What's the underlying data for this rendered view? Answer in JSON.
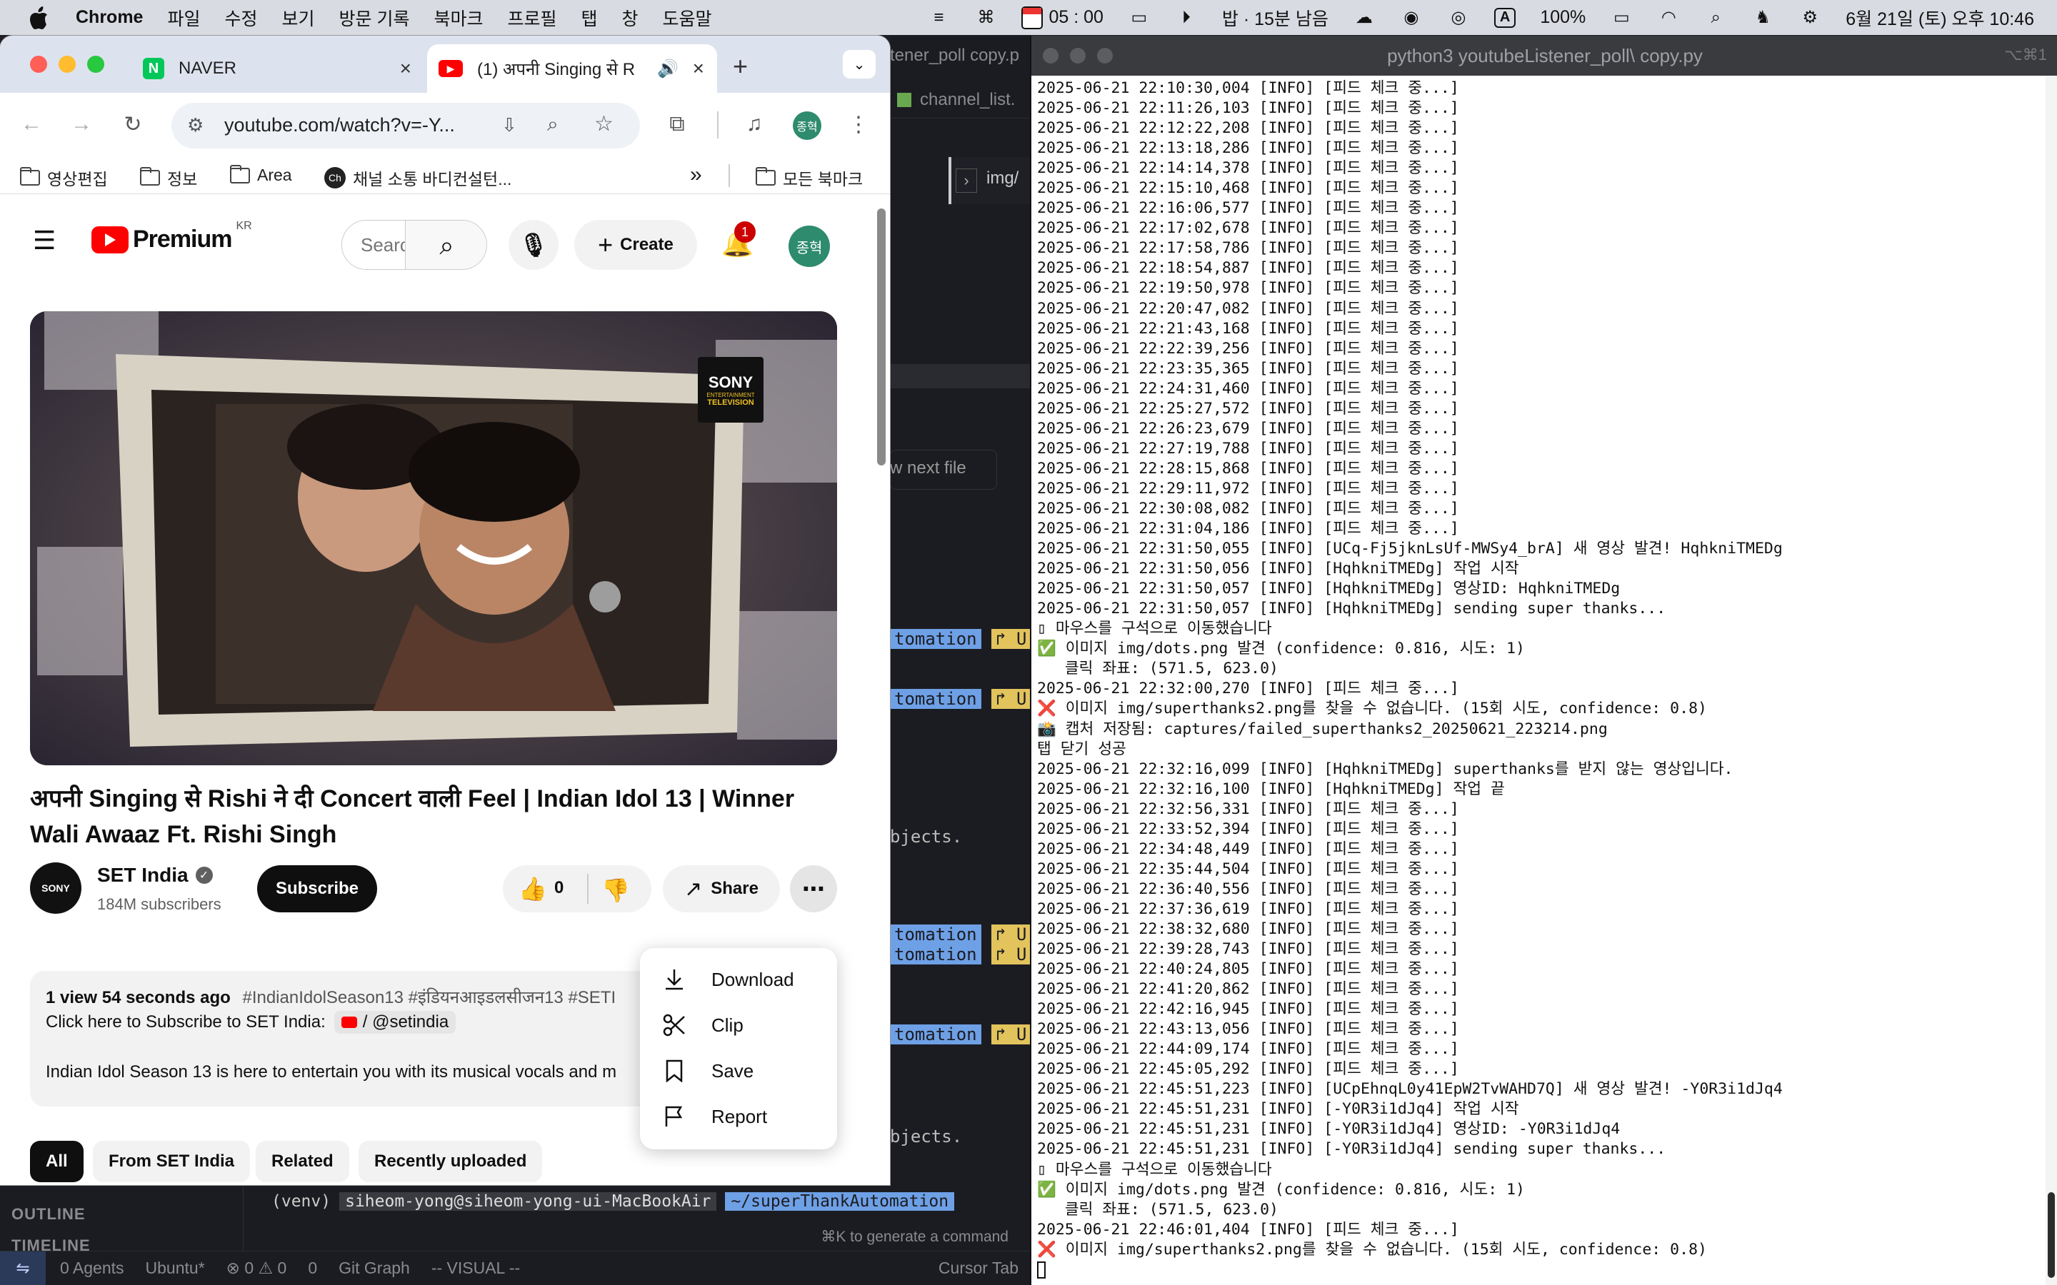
{
  "menubar": {
    "app": "Chrome",
    "items": [
      "파일",
      "수정",
      "보기",
      "방문 기록",
      "북마크",
      "프로필",
      "탭",
      "창",
      "도움말"
    ],
    "timer": "05 : 00",
    "rice": "밥 · 15분 남음",
    "input_source": "A",
    "battery": "100%",
    "datetime": "6월 21일 (토) 오후 10:46"
  },
  "chrome": {
    "tabs": [
      {
        "title": "NAVER",
        "fav": "N",
        "fav_color": "#03c75a"
      },
      {
        "title": "(1) अपनी Singing से R",
        "fav": "▶",
        "fav_color": "#ff0000"
      }
    ],
    "url": "youtube.com/watch?v=-Y...",
    "profile": "종혁",
    "bookmarks": [
      "영상편집",
      "정보",
      "Area",
      "채널 소통 바디컨설턴...",
      "모든 북마크"
    ]
  },
  "youtube": {
    "logo_text": "Premium",
    "region": "KR",
    "search_placeholder": "Search",
    "create_label": "Create",
    "notif_count": "1",
    "avatar": "종혁",
    "video_title": "अपनी Singing से Rishi ने दी Concert वाली Feel | Indian Idol 13 | Winner Wali Awaaz Ft. Rishi Singh",
    "watermark_line1": "SONY",
    "watermark_line2": "ENTERTAINMENT",
    "watermark_line3": "TELEVISION",
    "channel": "SET India",
    "subscribers": "184M subscribers",
    "subscribe": "Subscribe",
    "likes": "0",
    "share": "Share",
    "menu": [
      "Download",
      "Clip",
      "Save",
      "Report"
    ],
    "desc_stats": "1 view  54 seconds ago",
    "desc_tags": "#IndianIdolSeason13 #इंडियनआइडलसीजन13 #SETI",
    "desc_line2": "Click here to Subscribe to SET India:",
    "desc_handle": "/ @setindia",
    "desc_line3": "Indian Idol Season 13 is here to entertain you with its musical vocals and m",
    "chips": [
      "All",
      "From SET India",
      "Related",
      "Recently uploaded"
    ]
  },
  "editor": {
    "tab1": "tener_poll copy.p",
    "tab2": "channel_list.",
    "path": "img/",
    "next_file": "w next file",
    "pill_blue": "tomation",
    "pill_yellow": "↱ U",
    "objects": "bjects.",
    "sidebar_outline": "OUTLINE",
    "sidebar_timeline": "TIMELINE",
    "prompt_env": "(venv)",
    "prompt_user": "siheom-yong@siheom-yong-ui-MacBookAir",
    "prompt_path": "~/superThankAutomation",
    "hint": "⌘K to generate a command",
    "status": [
      "0 Agents",
      "Ubuntu*",
      "⊗ 0 ⚠ 0",
      "0",
      "Git Graph",
      "-- VISUAL --",
      "Cursor Tab"
    ]
  },
  "terminal": {
    "title": "python3 youtubeListener_poll\\ copy.py",
    "shortcut": "⌥⌘1",
    "lines": [
      "2025-06-21 22:10:30,004 [INFO] [피드 체크 중...]",
      "2025-06-21 22:11:26,103 [INFO] [피드 체크 중...]",
      "2025-06-21 22:12:22,208 [INFO] [피드 체크 중...]",
      "2025-06-21 22:13:18,286 [INFO] [피드 체크 중...]",
      "2025-06-21 22:14:14,378 [INFO] [피드 체크 중...]",
      "2025-06-21 22:15:10,468 [INFO] [피드 체크 중...]",
      "2025-06-21 22:16:06,577 [INFO] [피드 체크 중...]",
      "2025-06-21 22:17:02,678 [INFO] [피드 체크 중...]",
      "2025-06-21 22:17:58,786 [INFO] [피드 체크 중...]",
      "2025-06-21 22:18:54,887 [INFO] [피드 체크 중...]",
      "2025-06-21 22:19:50,978 [INFO] [피드 체크 중...]",
      "2025-06-21 22:20:47,082 [INFO] [피드 체크 중...]",
      "2025-06-21 22:21:43,168 [INFO] [피드 체크 중...]",
      "2025-06-21 22:22:39,256 [INFO] [피드 체크 중...]",
      "2025-06-21 22:23:35,365 [INFO] [피드 체크 중...]",
      "2025-06-21 22:24:31,460 [INFO] [피드 체크 중...]",
      "2025-06-21 22:25:27,572 [INFO] [피드 체크 중...]",
      "2025-06-21 22:26:23,679 [INFO] [피드 체크 중...]",
      "2025-06-21 22:27:19,788 [INFO] [피드 체크 중...]",
      "2025-06-21 22:28:15,868 [INFO] [피드 체크 중...]",
      "2025-06-21 22:29:11,972 [INFO] [피드 체크 중...]",
      "2025-06-21 22:30:08,082 [INFO] [피드 체크 중...]",
      "2025-06-21 22:31:04,186 [INFO] [피드 체크 중...]",
      "2025-06-21 22:31:50,055 [INFO] [UCq-Fj5jknLsUf-MWSy4_brA] 새 영상 발견! HqhkniTMEDg",
      "2025-06-21 22:31:50,056 [INFO] [HqhkniTMEDg] 작업 시작",
      "2025-06-21 22:31:50,057 [INFO] [HqhkniTMEDg] 영상ID: HqhkniTMEDg",
      "2025-06-21 22:31:50,057 [INFO] [HqhkniTMEDg] sending super thanks...",
      "▯ 마우스를 구석으로 이동했습니다",
      "✅ 이미지 img/dots.png 발견 (confidence: 0.816, 시도: 1)",
      "   클릭 좌표: (571.5, 623.0)",
      "2025-06-21 22:32:00,270 [INFO] [피드 체크 중...]",
      "❌ 이미지 img/superthanks2.png를 찾을 수 없습니다. (15회 시도, confidence: 0.8)",
      "📸 캡처 저장됨: captures/failed_superthanks2_20250621_223214.png",
      "탭 닫기 성공",
      "2025-06-21 22:32:16,099 [INFO] [HqhkniTMEDg] superthanks를 받지 않는 영상입니다.",
      "2025-06-21 22:32:16,100 [INFO] [HqhkniTMEDg] 작업 끝",
      "2025-06-21 22:32:56,331 [INFO] [피드 체크 중...]",
      "2025-06-21 22:33:52,394 [INFO] [피드 체크 중...]",
      "2025-06-21 22:34:48,449 [INFO] [피드 체크 중...]",
      "2025-06-21 22:35:44,504 [INFO] [피드 체크 중...]",
      "2025-06-21 22:36:40,556 [INFO] [피드 체크 중...]",
      "2025-06-21 22:37:36,619 [INFO] [피드 체크 중...]",
      "2025-06-21 22:38:32,680 [INFO] [피드 체크 중...]",
      "2025-06-21 22:39:28,743 [INFO] [피드 체크 중...]",
      "2025-06-21 22:40:24,805 [INFO] [피드 체크 중...]",
      "2025-06-21 22:41:20,862 [INFO] [피드 체크 중...]",
      "2025-06-21 22:42:16,945 [INFO] [피드 체크 중...]",
      "2025-06-21 22:43:13,056 [INFO] [피드 체크 중...]",
      "2025-06-21 22:44:09,174 [INFO] [피드 체크 중...]",
      "2025-06-21 22:45:05,292 [INFO] [피드 체크 중...]",
      "2025-06-21 22:45:51,223 [INFO] [UCpEhnqL0y41EpW2TvWAHD7Q] 새 영상 발견! -Y0R3i1dJq4",
      "2025-06-21 22:45:51,231 [INFO] [-Y0R3i1dJq4] 작업 시작",
      "2025-06-21 22:45:51,231 [INFO] [-Y0R3i1dJq4] 영상ID: -Y0R3i1dJq4",
      "2025-06-21 22:45:51,231 [INFO] [-Y0R3i1dJq4] sending super thanks...",
      "▯ 마우스를 구석으로 이동했습니다",
      "✅ 이미지 img/dots.png 발견 (confidence: 0.816, 시도: 1)",
      "   클릭 좌표: (571.5, 623.0)",
      "2025-06-21 22:46:01,404 [INFO] [피드 체크 중...]",
      "❌ 이미지 img/superthanks2.png를 찾을 수 없습니다. (15회 시도, confidence: 0.8)"
    ]
  }
}
